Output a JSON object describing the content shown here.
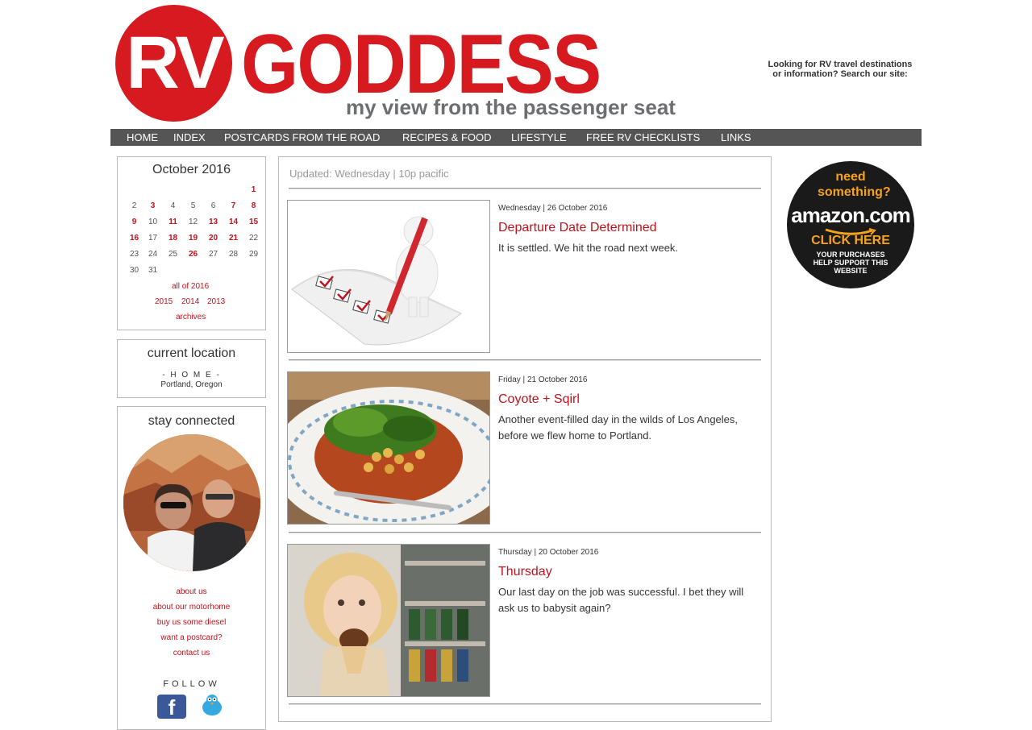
{
  "header": {
    "logo_rv": "RV",
    "logo_goddess": "GODDESS",
    "tagline": "my view from the passenger seat",
    "search_note_line1": "Looking for RV travel destinations",
    "search_note_line2": "or information? Search our site:"
  },
  "nav": [
    "HOME",
    "INDEX",
    "POSTCARDS FROM THE ROAD",
    "RECIPES & FOOD",
    "LIFESTYLE",
    "FREE RV CHECKLISTS",
    "LINKS"
  ],
  "calendar": {
    "title": "October 2016",
    "rows": [
      [
        "",
        "",
        "",
        "",
        "",
        "",
        "1"
      ],
      [
        "2",
        "3",
        "4",
        "5",
        "6",
        "7",
        "8"
      ],
      [
        "9",
        "10",
        "11",
        "12",
        "13",
        "14",
        "15"
      ],
      [
        "16",
        "17",
        "18",
        "19",
        "20",
        "21",
        "22"
      ],
      [
        "23",
        "24",
        "25",
        "26",
        "27",
        "28",
        "29"
      ],
      [
        "30",
        "31",
        "",
        "",
        "",
        "",
        ""
      ]
    ],
    "linked_days": [
      "1",
      "3",
      "7",
      "8",
      "9",
      "11",
      "13",
      "14",
      "15",
      "16",
      "18",
      "19",
      "20",
      "21",
      "26"
    ],
    "all_year": "all of 2016",
    "years": [
      "2015",
      "2014",
      "2013"
    ],
    "archives": "archives"
  },
  "location": {
    "title": "current location",
    "home": "- H O M E -",
    "city": "Portland, Oregon"
  },
  "stay_connected": {
    "title": "stay connected",
    "links": [
      "about us",
      "about our motorhome",
      "buy us some diesel",
      "want a postcard?",
      "contact us"
    ],
    "follow": "FOLLOW"
  },
  "main": {
    "updated": "Updated: Wednesday | 10p pacific",
    "posts": [
      {
        "date": "Wednesday | 26 October 2016",
        "title": "Departure Date Determined",
        "text": "It is settled. We hit the road next week."
      },
      {
        "date": "Friday | 21 October 2016",
        "title": "Coyote + Sqirl",
        "text": "Another event-filled day in the wilds of Los Angeles, before we flew home to Portland."
      },
      {
        "date": "Thursday | 20 October 2016",
        "title": "Thursday",
        "text": "Our last day on the job was successful. I bet they will ask us to babysit again?"
      }
    ]
  },
  "amazon": {
    "need": "need something?",
    "logo": "amazon.com",
    "click": "CLICK HERE",
    "sub": "YOUR PURCHASES HELP SUPPORT THIS WEBSITE"
  },
  "colors": {
    "brand_red": "#d71920",
    "link_red": "#c1131b",
    "nav_bg": "#555555",
    "amazon_orange": "#f7a21b"
  }
}
